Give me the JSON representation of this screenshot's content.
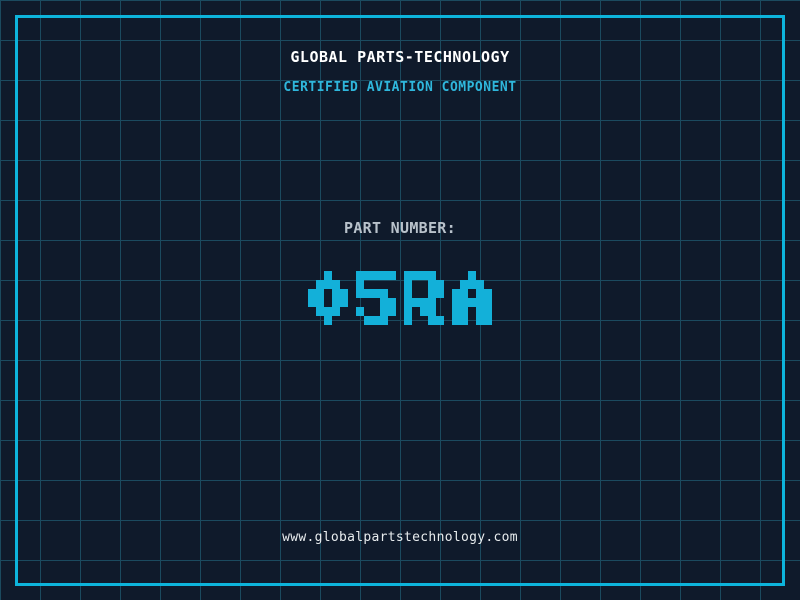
{
  "header": {
    "title": "GLOBAL PARTS-TECHNOLOGY",
    "subtitle": "CERTIFIED AVIATION COMPONENT"
  },
  "part": {
    "label": "PART NUMBER:",
    "number": "05RA"
  },
  "footer": {
    "website": "www.globalpartstechnology.com"
  },
  "colors": {
    "background": "#0f1a2b",
    "grid_line": "#1b4a5f",
    "frame": "#0db4dc",
    "title": "#ffffff",
    "subtitle": "#2fb7dc",
    "part_label": "#b9c2cb",
    "part_number": "#13b0d9",
    "website": "#e8ecee"
  }
}
